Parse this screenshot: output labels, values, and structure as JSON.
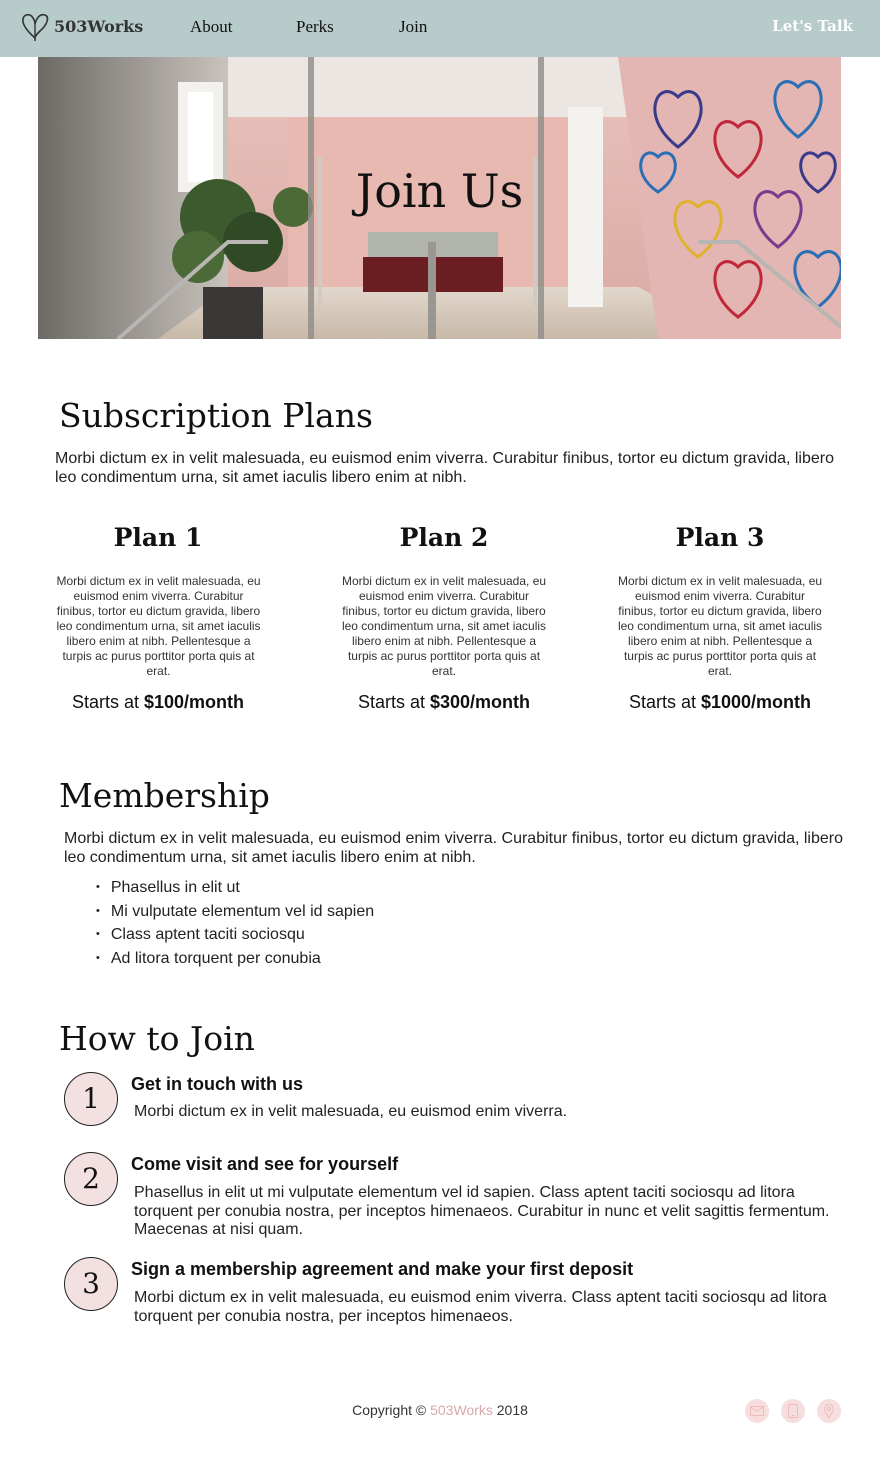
{
  "nav": {
    "logo_text": "503Works",
    "links": [
      "About",
      "Perks",
      "Join"
    ],
    "cta": "Let's Talk"
  },
  "hero": {
    "title": "Join Us"
  },
  "subscription": {
    "heading": "Subscription Plans",
    "intro": "Morbi dictum ex in velit malesuada, eu euismod enim viverra. Curabitur finibus, tortor eu dictum gravida, libero leo condimentum urna, sit amet iaculis libero enim at nibh.",
    "plans": [
      {
        "title": "Plan 1",
        "description": "Morbi dictum ex in velit malesuada, eu euismod enim viverra. Curabitur finibus, tortor eu dictum gravida, libero leo condimentum urna, sit amet iaculis libero enim at nibh. Pellentesque a turpis ac purus porttitor porta quis at erat.",
        "price_prefix": "Starts at ",
        "price": "$100/month"
      },
      {
        "title": "Plan 2",
        "description": "Morbi dictum ex in velit malesuada, eu euismod enim viverra. Curabitur finibus, tortor eu dictum gravida, libero leo condimentum urna, sit amet iaculis libero enim at nibh. Pellentesque a turpis ac purus porttitor porta quis at erat.",
        "price_prefix": "Starts at ",
        "price": "$300/month"
      },
      {
        "title": "Plan 3",
        "description": "Morbi dictum ex in velit malesuada, eu euismod enim viverra. Curabitur finibus, tortor eu dictum gravida, libero leo condimentum urna, sit amet iaculis libero enim at nibh. Pellentesque a turpis ac purus porttitor porta quis at erat.",
        "price_prefix": "Starts at ",
        "price": "$1000/month"
      }
    ]
  },
  "membership": {
    "heading": "Membership",
    "intro": "Morbi dictum ex in velit malesuada, eu euismod enim viverra. Curabitur finibus, tortor eu dictum gravida, libero leo condimentum urna, sit amet iaculis libero enim at nibh.",
    "bullets": [
      "Phasellus in elit ut",
      "Mi vulputate elementum vel id sapien",
      "Class aptent taciti sociosqu",
      "Ad litora torquent per conubia"
    ]
  },
  "how_to_join": {
    "heading": "How to Join",
    "steps": [
      {
        "number": "1",
        "title": "Get in touch with us",
        "text": "Morbi dictum ex in velit malesuada, eu euismod enim viverra."
      },
      {
        "number": "2",
        "title": "Come visit and see for yourself",
        "text": "Phasellus in elit ut mi vulputate elementum vel id sapien. Class aptent taciti sociosqu ad litora torquent per conubia nostra, per inceptos himenaeos. Curabitur in nunc et velit sagittis fermentum. Maecenas at nisi quam."
      },
      {
        "number": "3",
        "title": "Sign a membership agreement and make your first deposit",
        "text": "Morbi dictum ex in velit malesuada, eu euismod enim viverra. Class aptent taciti sociosqu ad litora torquent per conubia nostra, per inceptos himenaeos."
      }
    ]
  },
  "footer": {
    "copyright_prefix": "Copyright © ",
    "brand": "503Works",
    "year": " 2018",
    "icons": [
      "mail-icon",
      "phone-icon",
      "location-icon"
    ]
  },
  "colors": {
    "nav_bg": "#b7cbcb",
    "step_circle_bg": "#f3e1e1",
    "footer_brand": "#d9a9a9",
    "social_icon_bg": "#f6dede"
  }
}
